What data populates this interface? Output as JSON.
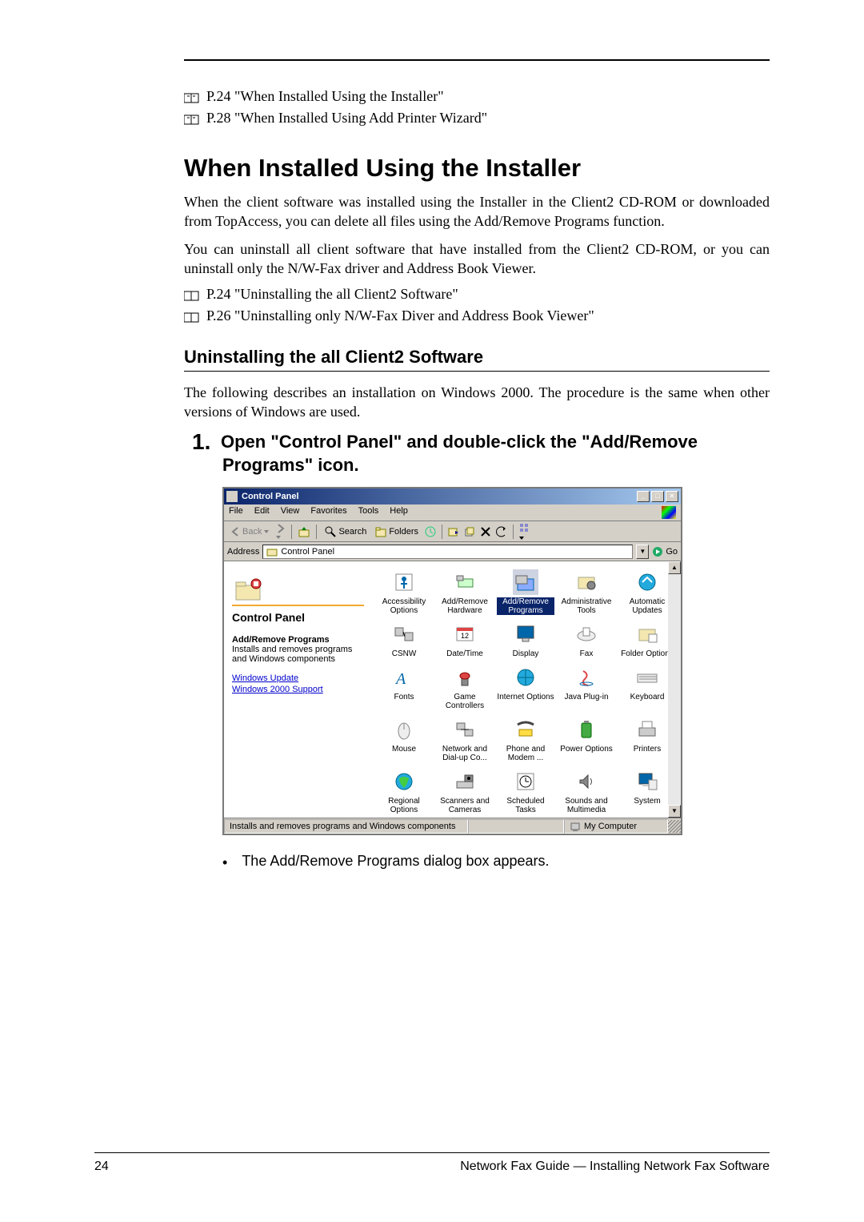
{
  "refs": {
    "r1": "P.24 \"When Installed Using the Installer\"",
    "r2": "P.28 \"When Installed Using Add Printer Wizard\"",
    "r3": "P.24 \"Uninstalling the all Client2 Software\"",
    "r4": "P.26 \"Uninstalling only N/W-Fax Diver and Address Book Viewer\""
  },
  "headings": {
    "h2": "When Installed Using the Installer",
    "h3": "Uninstalling the all Client2 Software"
  },
  "paragraphs": {
    "p1": "When the client software was installed using the Installer in the Client2 CD-ROM or downloaded from TopAccess, you can delete all files using the Add/Remove Programs function.",
    "p2": "You can uninstall all client software that have installed from the Client2 CD-ROM, or you can uninstall only the N/W-Fax driver and Address Book Viewer.",
    "p3": "The following describes an installation on Windows 2000.  The procedure is the same when other versions of Windows are used."
  },
  "step": {
    "num": "1.",
    "text": "Open \"Control Panel\" and double-click the \"Add/Remove Programs\" icon."
  },
  "bullet": {
    "text": "The Add/Remove Programs dialog box appears."
  },
  "cp": {
    "title": "Control Panel",
    "menu": {
      "file": "File",
      "edit": "Edit",
      "view": "View",
      "favorites": "Favorites",
      "tools": "Tools",
      "help": "Help"
    },
    "toolbar": {
      "back": "Back",
      "search": "Search",
      "folders": "Folders"
    },
    "addr": {
      "label": "Address",
      "value": "Control Panel",
      "go": "Go"
    },
    "side": {
      "title": "Control Panel",
      "itemTitle": "Add/Remove Programs",
      "itemDesc": "Installs and removes programs and Windows components",
      "link1": "Windows Update",
      "link2": "Windows 2000 Support"
    },
    "icons": {
      "i0": "Accessibility Options",
      "i1": "Add/Remove Hardware",
      "i2": "Add/Remove Programs",
      "i3": "Administrative Tools",
      "i4": "Automatic Updates",
      "i5": "CSNW",
      "i6": "Date/Time",
      "i7": "Display",
      "i8": "Fax",
      "i9": "Folder Options",
      "i10": "Fonts",
      "i11": "Game Controllers",
      "i12": "Internet Options",
      "i13": "Java Plug-in",
      "i14": "Keyboard",
      "i15": "Mouse",
      "i16": "Network and Dial-up Co...",
      "i17": "Phone and Modem ...",
      "i18": "Power Options",
      "i19": "Printers",
      "i20": "Regional Options",
      "i21": "Scanners and Cameras",
      "i22": "Scheduled Tasks",
      "i23": "Sounds and Multimedia",
      "i24": "System"
    },
    "status": {
      "text": "Installs and removes programs and Windows components",
      "loc": "My Computer"
    }
  },
  "footer": {
    "page": "24",
    "title": "Network Fax Guide — Installing Network Fax Software"
  }
}
